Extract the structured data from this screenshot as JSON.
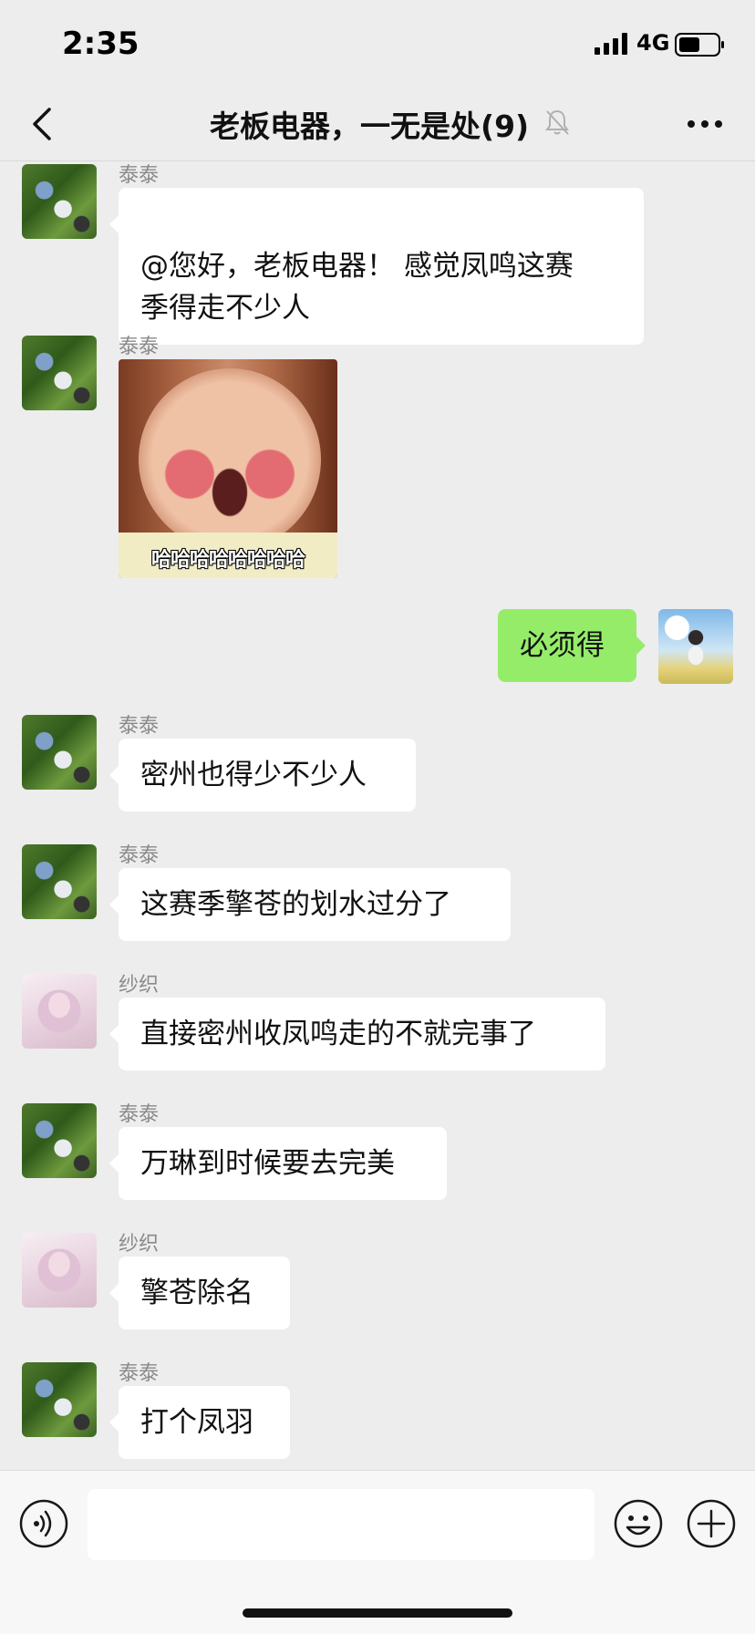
{
  "status_bar": {
    "time": "2:35",
    "network": "4G"
  },
  "header": {
    "title": "老板电器，一无是处(9)"
  },
  "messages": [
    {
      "sender": "泰泰",
      "text": "@您好，老板电器！ 感觉凤鸣这赛\n季得走不少人",
      "avatar": "green-field-avatar"
    },
    {
      "sender": "泰泰",
      "sticker_caption": "哈哈哈哈哈哈哈哈",
      "avatar": "green-field-avatar"
    },
    {
      "text": "必须得",
      "self": true,
      "avatar": "anime-boy-avatar"
    },
    {
      "sender": "泰泰",
      "text": "密州也得少不少人",
      "avatar": "green-field-avatar"
    },
    {
      "sender": "泰泰",
      "text": "这赛季擎苍的划水过分了",
      "avatar": "green-field-avatar"
    },
    {
      "sender": "纱织",
      "text": "直接密州收凤鸣走的不就完事了",
      "avatar": "anime-girl-avatar"
    },
    {
      "sender": "泰泰",
      "text": "万琳到时候要去完美",
      "avatar": "green-field-avatar"
    },
    {
      "sender": "纱织",
      "text": "擎苍除名",
      "avatar": "anime-girl-avatar"
    },
    {
      "sender": "泰泰",
      "text": "打个凤羽",
      "avatar": "green-field-avatar"
    }
  ],
  "input": {
    "value": "",
    "placeholder": ""
  },
  "colors": {
    "background": "#ededed",
    "self_bubble": "#95ec69",
    "other_bubble": "#ffffff"
  }
}
